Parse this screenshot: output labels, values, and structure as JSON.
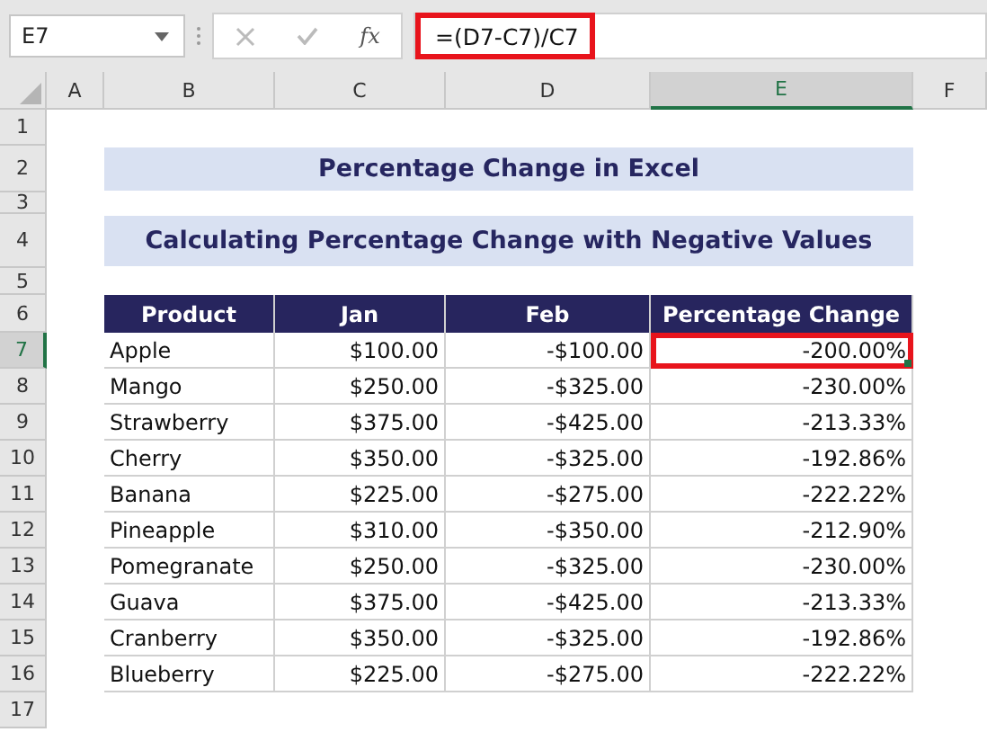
{
  "name_box": "E7",
  "function_button": "fx",
  "formula": {
    "text": "=(D7-C7)/C7",
    "highlighted": true
  },
  "columns": [
    {
      "label": "A",
      "selected": false
    },
    {
      "label": "B",
      "selected": false
    },
    {
      "label": "C",
      "selected": false
    },
    {
      "label": "D",
      "selected": false
    },
    {
      "label": "E",
      "selected": true
    },
    {
      "label": "F",
      "selected": false
    }
  ],
  "row_numbers": [
    {
      "label": "1",
      "selected": false
    },
    {
      "label": "2",
      "selected": false
    },
    {
      "label": "3",
      "selected": false
    },
    {
      "label": "4",
      "selected": false
    },
    {
      "label": "5",
      "selected": false
    },
    {
      "label": "6",
      "selected": false
    },
    {
      "label": "7",
      "selected": true
    },
    {
      "label": "8",
      "selected": false
    },
    {
      "label": "9",
      "selected": false
    },
    {
      "label": "10",
      "selected": false
    },
    {
      "label": "11",
      "selected": false
    },
    {
      "label": "12",
      "selected": false
    },
    {
      "label": "13",
      "selected": false
    },
    {
      "label": "14",
      "selected": false
    },
    {
      "label": "15",
      "selected": false
    },
    {
      "label": "16",
      "selected": false
    },
    {
      "label": "17",
      "selected": false
    }
  ],
  "title": "Percentage Change in Excel",
  "subtitle": "Calculating Percentage Change with Negative Values",
  "table": {
    "columns": [
      "Product",
      "Jan",
      "Feb",
      "Percentage Change"
    ],
    "rows": [
      {
        "cells": [
          "Apple",
          "$100.00",
          "-$100.00",
          "-200.00%"
        ],
        "selected": true,
        "highlighted": true
      },
      {
        "cells": [
          "Mango",
          "$250.00",
          "-$325.00",
          "-230.00%"
        ],
        "selected": false,
        "highlighted": false
      },
      {
        "cells": [
          "Strawberry",
          "$375.00",
          "-$425.00",
          "-213.33%"
        ],
        "selected": false,
        "highlighted": false
      },
      {
        "cells": [
          "Cherry",
          "$350.00",
          "-$325.00",
          "-192.86%"
        ],
        "selected": false,
        "highlighted": false
      },
      {
        "cells": [
          "Banana",
          "$225.00",
          "-$275.00",
          "-222.22%"
        ],
        "selected": false,
        "highlighted": false
      },
      {
        "cells": [
          "Pineapple",
          "$310.00",
          "-$350.00",
          "-212.90%"
        ],
        "selected": false,
        "highlighted": false
      },
      {
        "cells": [
          "Pomegranate",
          "$250.00",
          "-$325.00",
          "-230.00%"
        ],
        "selected": false,
        "highlighted": false
      },
      {
        "cells": [
          "Guava",
          "$375.00",
          "-$425.00",
          "-213.33%"
        ],
        "selected": false,
        "highlighted": false
      },
      {
        "cells": [
          "Cranberry",
          "$350.00",
          "-$325.00",
          "-192.86%"
        ],
        "selected": false,
        "highlighted": false
      },
      {
        "cells": [
          "Blueberry",
          "$225.00",
          "-$275.00",
          "-222.22%"
        ],
        "selected": false,
        "highlighted": false
      }
    ]
  }
}
